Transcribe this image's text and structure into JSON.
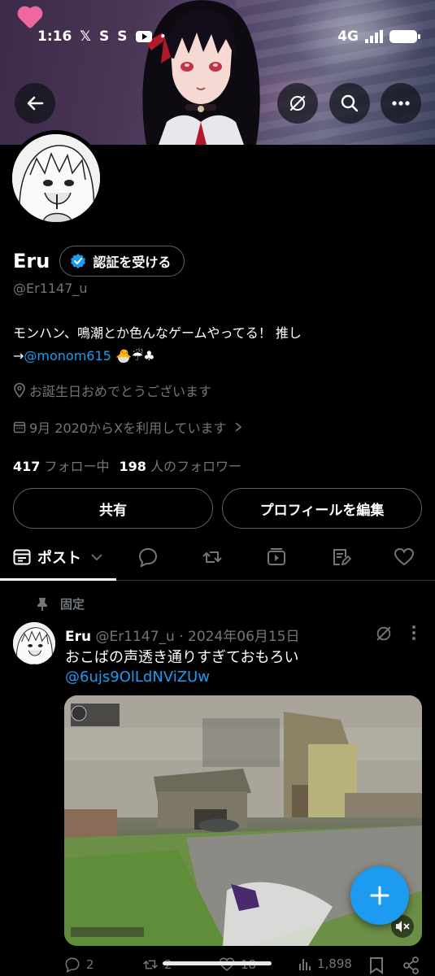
{
  "status_bar": {
    "time": "1:16",
    "notif_1": "𝕏",
    "notif_2": "S",
    "notif_3": "S",
    "dot": "•",
    "network": "4G"
  },
  "profile": {
    "name": "Eru",
    "verify_label": "認証を受ける",
    "handle": "@Er1147_u",
    "bio_line1": "モンハン、鳴潮とか色んなゲームやってる！ 推し",
    "bio_arrow": "→",
    "bio_link": "@monom615",
    "bio_emoji": "🐣☔♣",
    "location": "お誕生日おめでとうございます",
    "joined": "9月 2020からXを利用しています",
    "following_count": "417",
    "following_label": "フォロー中",
    "followers_count": "198",
    "followers_label": "人のフォロワー",
    "share_label": "共有",
    "edit_label": "プロフィールを編集"
  },
  "tabs": {
    "active_label": "ポスト"
  },
  "pinned_post": {
    "pinned_label": "固定",
    "author": "Eru",
    "handle": "@Er1147_u",
    "sep": "·",
    "date": "2024年06月15日",
    "text": "おこばの声透き通りすぎておもろい",
    "link": "@6ujs9OlLdNViZUw",
    "replies": "2",
    "reposts": "2",
    "likes": "18",
    "views": "1,898"
  },
  "colors": {
    "accent": "#1d9bf0",
    "background": "#000000",
    "muted": "#71767b",
    "border": "#536471"
  }
}
